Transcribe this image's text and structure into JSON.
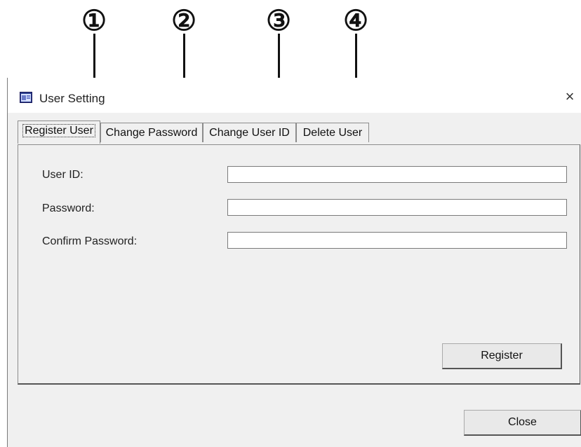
{
  "callouts": [
    "①",
    "②",
    "③",
    "④"
  ],
  "window": {
    "title": "User Setting",
    "close_glyph": "×"
  },
  "tabs": [
    {
      "label": "Register User",
      "active": true
    },
    {
      "label": "Change Password",
      "active": false
    },
    {
      "label": "Change User ID",
      "active": false
    },
    {
      "label": "Delete User",
      "active": false
    }
  ],
  "form": {
    "user_id_label": "User ID:",
    "user_id_value": "",
    "password_label": "Password:",
    "password_value": "",
    "confirm_label": "Confirm Password:",
    "confirm_value": "",
    "register_button": "Register"
  },
  "footer": {
    "close_button": "Close"
  }
}
